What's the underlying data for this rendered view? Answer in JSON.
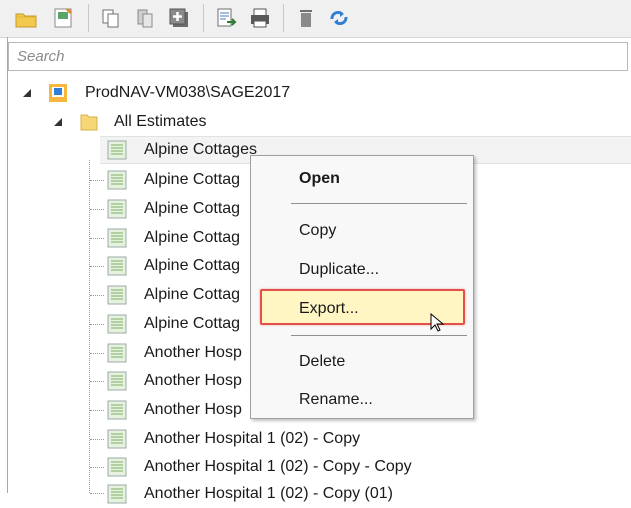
{
  "toolbar": {
    "buttons": [
      {
        "icon": "new-folder-icon"
      },
      {
        "icon": "new-estimate-icon"
      },
      {
        "icon": "copy-icon"
      },
      {
        "icon": "paste-icon"
      },
      {
        "icon": "add-icon"
      },
      {
        "icon": "export-icon"
      },
      {
        "icon": "print-icon"
      },
      {
        "icon": "delete-icon"
      },
      {
        "icon": "refresh-icon"
      }
    ]
  },
  "search": {
    "placeholder": "Search"
  },
  "tree": {
    "server": "ProdNAV-VM038\\SAGE2017",
    "folder": "All Estimates",
    "items": [
      "Alpine Cottages",
      "Alpine Cottag",
      "Alpine Cottag",
      "Alpine Cottag",
      "Alpine Cottag",
      "Alpine Cottag",
      "Alpine Cottag",
      "Another Hosp",
      "Another Hosp",
      "Another Hosp",
      "Another Hospital 1 (02) - Copy",
      "Another Hospital 1 (02) - Copy - Copy",
      "Another Hospital 1 (02) - Copy (01)"
    ]
  },
  "context_menu": {
    "open": "Open",
    "copy": "Copy",
    "duplicate": "Duplicate...",
    "export": "Export...",
    "delete": "Delete",
    "rename": "Rename..."
  },
  "colors": {
    "highlight_border": "#e3514a",
    "highlight_fill": "#fff6c4"
  }
}
